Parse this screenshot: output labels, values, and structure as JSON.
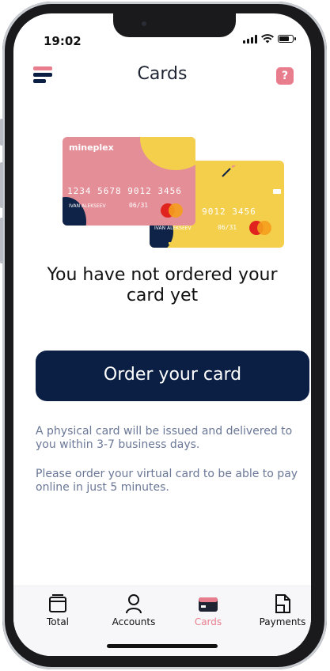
{
  "status_bar": {
    "time": "19:02",
    "battery_level": 0.8
  },
  "header": {
    "title": "Cards",
    "menu_icon": "menu-icon",
    "help_label": "?"
  },
  "illustration": {
    "front_card": {
      "brand": "mineplex",
      "number": "1234 5678 9012 3456",
      "holder": "IVAN ALEKSEEV",
      "expiry": "06/31"
    },
    "back_card": {
      "number": "5678 9012 3456",
      "holder": "IVAN ALEKSEEV",
      "expiry": "06/31"
    }
  },
  "empty_state": {
    "message": "You have not ordered your card yet"
  },
  "order_button": {
    "label": "Order your card"
  },
  "info": {
    "physical": "A physical card will be issued and delivered to you within 3-7 business days.",
    "virtual": "Please order your virtual card to be able to pay online in just 5 minutes."
  },
  "tabbar": {
    "active": "Cards",
    "items": [
      {
        "label": "Total",
        "icon": "wallet-icon"
      },
      {
        "label": "Accounts",
        "icon": "person-icon"
      },
      {
        "label": "Cards",
        "icon": "card-icon"
      },
      {
        "label": "Payments",
        "icon": "document-icon"
      }
    ]
  },
  "colors": {
    "navy": "#0b1f45",
    "accent_pink": "#e87d8d",
    "info_text": "#6a7796",
    "card_yellow": "#f3cf4b",
    "card_pink": "#e48f98"
  }
}
